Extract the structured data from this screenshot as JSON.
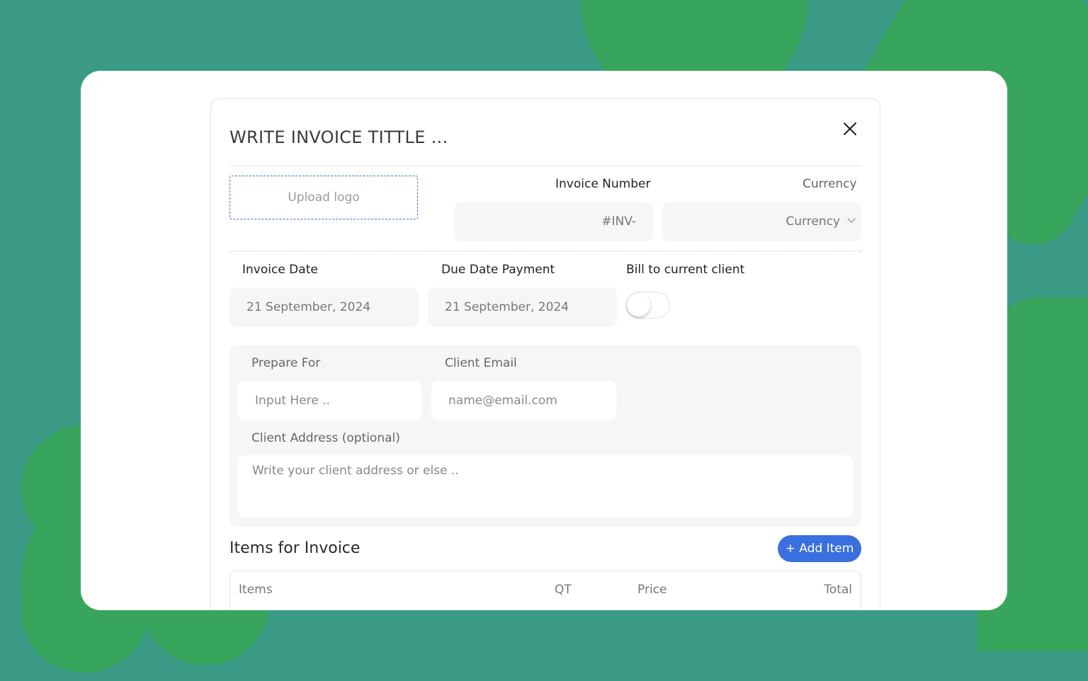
{
  "modal": {
    "title": "WRITE INVOICE TITTLE ...",
    "close_icon": "close-icon"
  },
  "header": {
    "upload_logo": "Upload logo",
    "invoice_number_label": "Invoice Number",
    "invoice_number_value": "#INV-",
    "currency_label": "Currency",
    "currency_select": "Currency"
  },
  "dates": {
    "invoice_date_label": "Invoice Date",
    "invoice_date_value": "21 September, 2024",
    "due_date_label": "Due Date Payment",
    "due_date_value": "21 September, 2024",
    "bill_to_label": "Bill to current client",
    "bill_to_enabled": false
  },
  "client": {
    "prepare_for_label": "Prepare For",
    "prepare_for_placeholder": "Input Here ..",
    "email_label": "Client Email",
    "email_placeholder": "name@email.com",
    "address_label": "Client Address (optional)",
    "address_placeholder": "Write your client address or else .."
  },
  "items": {
    "title": "Items for Invoice",
    "add_button": "+ Add Item",
    "columns": [
      "Items",
      "QT",
      "Price",
      "Total"
    ]
  },
  "colors": {
    "accent": "#3a6fe0",
    "background": "#3a9a86",
    "shape": "#37a55c"
  }
}
